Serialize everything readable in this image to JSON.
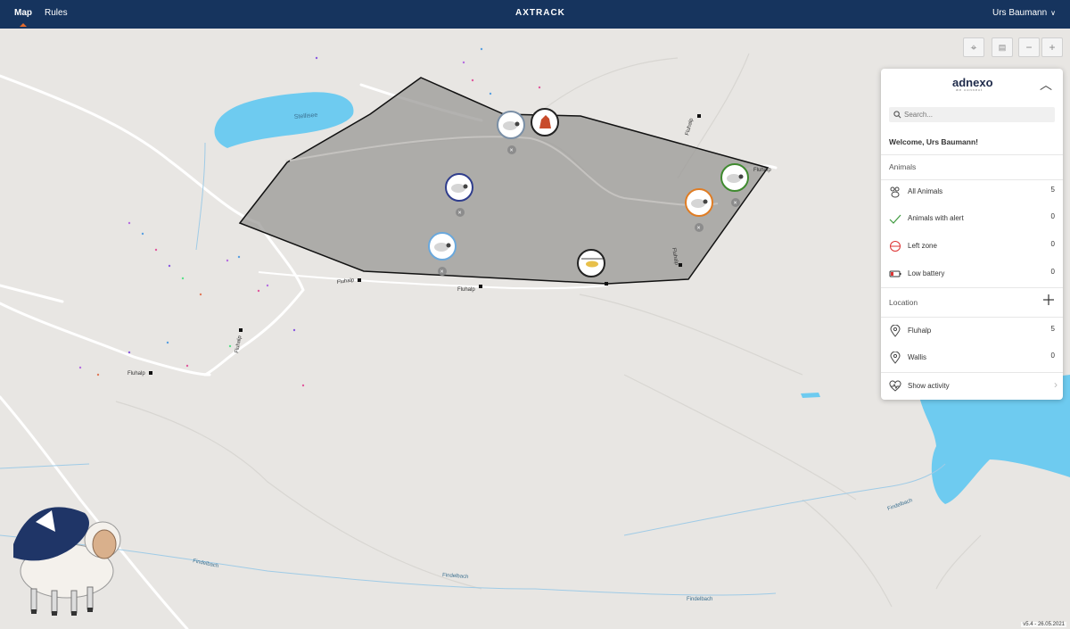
{
  "header": {
    "nav": [
      {
        "label": "Map"
      },
      {
        "label": "Rules"
      }
    ],
    "brand": "AXTRACK",
    "user": "Urs Baumann"
  },
  "map": {
    "lake_label": "Stellisee",
    "place_labels": [
      "Fluhalp",
      "Fluhalp",
      "Fluhalp",
      "Fluhalp",
      "Fluhalp",
      "Fluhalp",
      "Fluhalp"
    ],
    "stream_labels": [
      "Findelbach",
      "Findelbach",
      "Findelbach",
      "Findelbach"
    ],
    "animals": [
      {
        "kind": "sheep",
        "ring": "#7a8fa6"
      },
      {
        "kind": "dog",
        "ring": "#222222"
      },
      {
        "kind": "sheep",
        "ring": "#2f3d8c"
      },
      {
        "kind": "sheep",
        "ring": "#6aa8dc"
      },
      {
        "kind": "helicopter",
        "ring": "#222222"
      },
      {
        "kind": "sheep",
        "ring": "#e07d24"
      },
      {
        "kind": "sheep",
        "ring": "#3f8a2f"
      }
    ],
    "version": "v5.4 - 26.05.2021"
  },
  "controls": {
    "locate": "crosshair-icon",
    "layers": "layers-icon",
    "zoom_out": "−",
    "zoom_in": "+"
  },
  "panel": {
    "logo": "adnexo",
    "tagline": "we connect",
    "search_placeholder": "Search...",
    "welcome": "Welcome, Urs Baumann!",
    "animals_title": "Animals",
    "animals": [
      {
        "label": "All Animals",
        "count": "5",
        "icon": "paw-icon"
      },
      {
        "label": "Animals with alert",
        "count": "0",
        "icon": "check-icon"
      },
      {
        "label": "Left zone",
        "count": "0",
        "icon": "left-zone-icon"
      },
      {
        "label": "Low battery",
        "count": "0",
        "icon": "battery-icon"
      }
    ],
    "location_title": "Location",
    "locations": [
      {
        "label": "Fluhalp",
        "count": "5"
      },
      {
        "label": "Wallis",
        "count": "0"
      }
    ],
    "activity_label": "Show activity"
  }
}
